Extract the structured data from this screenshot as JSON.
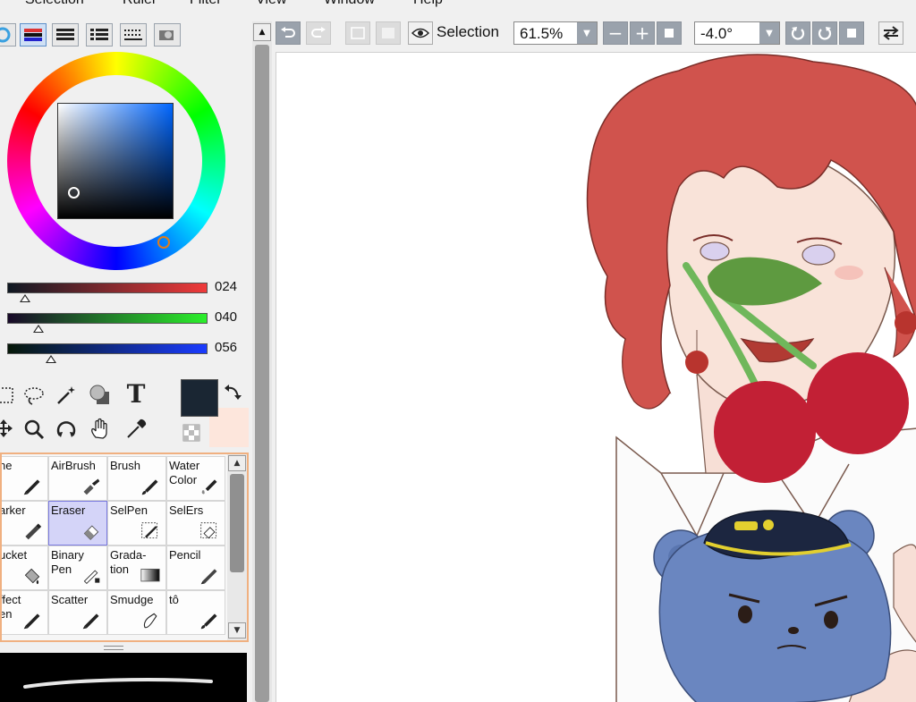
{
  "menu": [
    "Selection",
    "Ruler",
    "Filter",
    "View",
    "Window",
    "Help"
  ],
  "toolbar": {
    "selection_label": "Selection",
    "zoom_value": "61.5%",
    "rotation_value": "-4.0°"
  },
  "color": {
    "sliders": [
      {
        "value": "024",
        "from": "#0e1822",
        "to": "#f03a3a",
        "pos": 0.09
      },
      {
        "value": "040",
        "from": "#180828",
        "to": "#2bef2b",
        "pos": 0.157
      },
      {
        "value": "056",
        "from": "#061808",
        "to": "#1a3bff",
        "pos": 0.22
      }
    ],
    "foreground": "#1a2633",
    "background": "#fde6dc"
  },
  "brushes": [
    {
      "label": "ne",
      "icon": "pen"
    },
    {
      "label": "AirBrush",
      "icon": "airbrush"
    },
    {
      "label": "Brush",
      "icon": "brush"
    },
    {
      "label": "Water\nColor",
      "icon": "watercolor"
    },
    {
      "label": "arker",
      "icon": "marker"
    },
    {
      "label": "Eraser",
      "icon": "eraser",
      "selected": true
    },
    {
      "label": "SelPen",
      "icon": "selpen"
    },
    {
      "label": "SelErs",
      "icon": "selers"
    },
    {
      "label": "ucket",
      "icon": "bucket"
    },
    {
      "label": "Binary\nPen",
      "icon": "binarypen"
    },
    {
      "label": "Grada-\ntion",
      "icon": "gradation"
    },
    {
      "label": "Pencil",
      "icon": "pencil"
    },
    {
      "label": "ffect\nen",
      "icon": "pen"
    },
    {
      "label": "Scatter",
      "icon": "pen"
    },
    {
      "label": "Smudge",
      "icon": "smudge"
    },
    {
      "label": "tô",
      "icon": "brush"
    }
  ]
}
